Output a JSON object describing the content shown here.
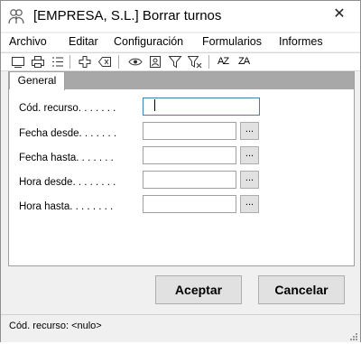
{
  "window": {
    "title": "[EMPRESA, S.L.] Borrar turnos",
    "close_glyph": "✕"
  },
  "menu": [
    "Archivo",
    "Editar",
    "Configuración",
    "Formularios",
    "Informes"
  ],
  "toolbar": {
    "icons": [
      "window-icon",
      "printer-icon",
      "list-icon",
      "add-icon",
      "delete-icon",
      "view-icon",
      "contact-card-icon",
      "filter-icon",
      "clear-filter-icon",
      "sort-ascending-icon",
      "sort-descending-icon"
    ],
    "sort_asc_label": "AZ",
    "sort_desc_label": "ZA"
  },
  "tab": {
    "label": "General"
  },
  "fields": [
    {
      "label": "Cód. recurso. . . . . . .",
      "value": ""
    },
    {
      "label": "Fecha desde. . . . . . .",
      "value": ""
    },
    {
      "label": "Fecha hasta. . . . . . .",
      "value": ""
    },
    {
      "label": "Hora desde. . . . . . . .",
      "value": ""
    },
    {
      "label": "Hora hasta. . . . . . . .",
      "value": ""
    }
  ],
  "lookup_button_label": "...",
  "buttons": {
    "accept": "Aceptar",
    "cancel": "Cancelar"
  },
  "status": "Cód. recurso: <nulo>"
}
